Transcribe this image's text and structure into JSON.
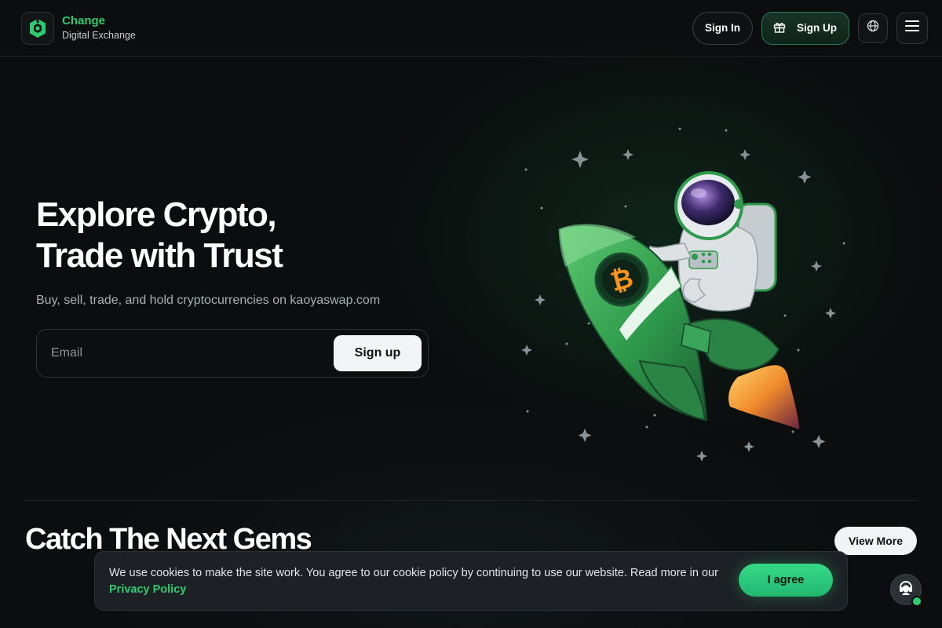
{
  "header": {
    "brand_name": "Change",
    "brand_sub": "Digital Exchange",
    "signin_label": "Sign In",
    "signup_label": "Sign Up",
    "icons": [
      "logo-icon",
      "gift-icon",
      "globe-icon",
      "menu-icon"
    ]
  },
  "hero": {
    "title_line1": "Explore Crypto,",
    "title_line2": "Trade with Trust",
    "subtitle": "Buy, sell, trade, and hold cryptocurrencies on kaoyaswap.com",
    "email_placeholder": "Email",
    "signup_button": "Sign up",
    "illustration": "astronaut-riding-bitcoin-rocket"
  },
  "gems": {
    "title": "Catch The Next Gems",
    "view_more": "View More"
  },
  "cookie": {
    "text": "We use cookies to make the site work. You agree to our cookie policy by continuing to use our website. Read more in our",
    "link": "Privacy Policy",
    "agree": "I agree"
  },
  "support": {
    "icon": "support-agent-icon",
    "status": "online"
  },
  "colors": {
    "accent": "#2ecc71",
    "background": "#0b0d0e",
    "bitcoin": "#f7931a"
  }
}
